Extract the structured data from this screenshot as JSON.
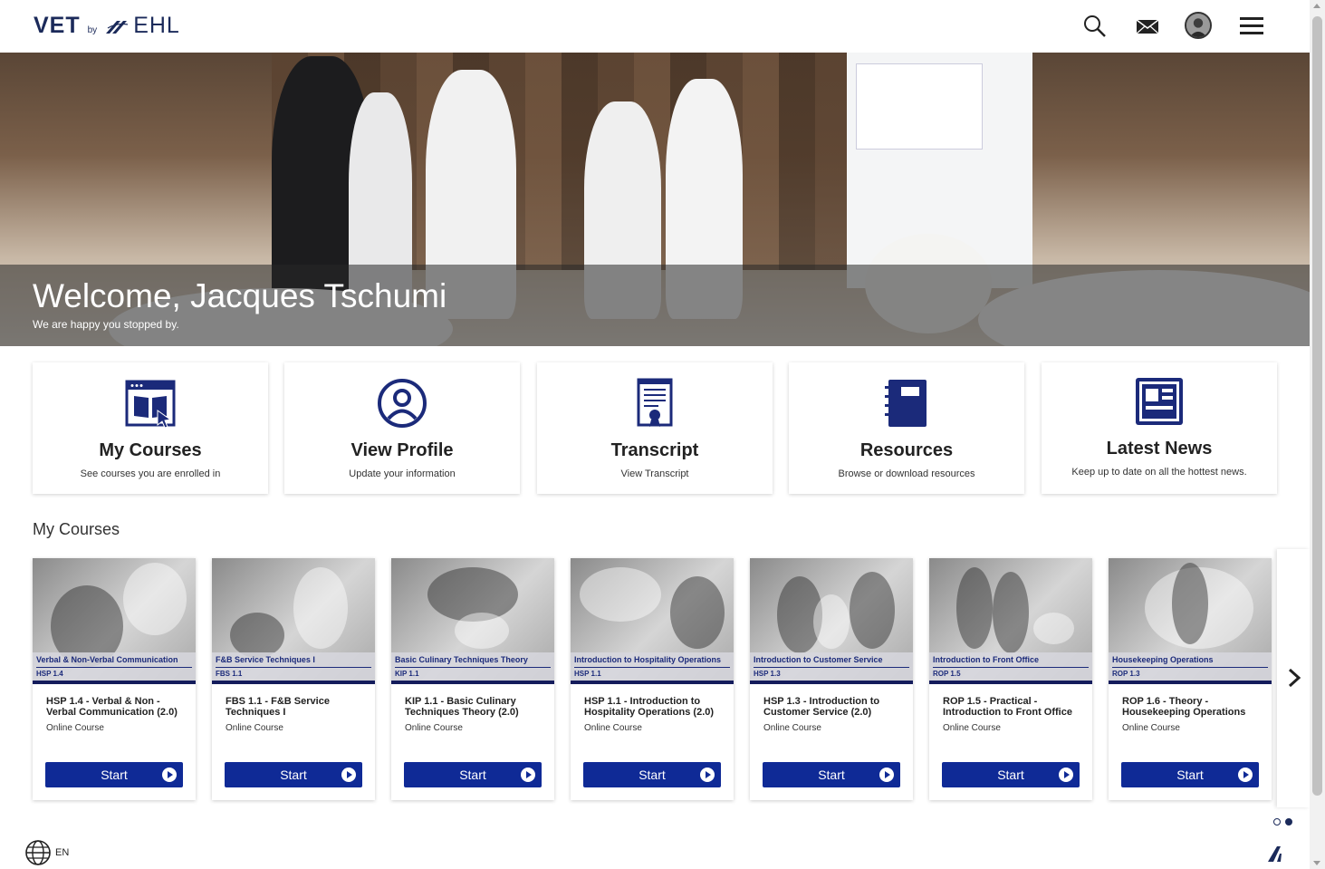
{
  "header": {
    "logo_vet": "VET",
    "logo_by": "by",
    "logo_ehl": "EHL",
    "icons": [
      "search-icon",
      "mail-icon",
      "avatar",
      "hamburger-menu-icon"
    ]
  },
  "hero": {
    "welcome": "Welcome, Jacques Tschumi",
    "subtitle": "We are happy you stopped by."
  },
  "tiles": [
    {
      "title": "My Courses",
      "subtitle": "See courses you are enrolled in",
      "icon": "course-book-icon"
    },
    {
      "title": "View Profile",
      "subtitle": "Update your information",
      "icon": "user-profile-icon"
    },
    {
      "title": "Transcript",
      "subtitle": "View Transcript",
      "icon": "certificate-icon"
    },
    {
      "title": "Resources",
      "subtitle": "Browse or download resources",
      "icon": "notebook-icon"
    },
    {
      "title": "Latest News",
      "subtitle": "Keep up to date on all the hottest news.",
      "icon": "newspaper-icon"
    }
  ],
  "section": {
    "title": "My Courses"
  },
  "courses": [
    {
      "band_title": "Verbal & Non-Verbal Communication",
      "band_code": "HSP 1.4",
      "title": "HSP 1.4 - Verbal & Non - Verbal Communication (2.0)",
      "type": "Online Course",
      "button": "Start"
    },
    {
      "band_title": "F&B Service Techniques I",
      "band_code": "FBS 1.1",
      "title": "FBS 1.1 - F&B Service Techniques I",
      "type": "Online Course",
      "button": "Start"
    },
    {
      "band_title": "Basic Culinary Techniques Theory",
      "band_code": "KIP 1.1",
      "title": "KIP 1.1 - Basic Culinary Techniques Theory (2.0)",
      "type": "Online Course",
      "button": "Start"
    },
    {
      "band_title": "Introduction to Hospitality Operations",
      "band_code": "HSP 1.1",
      "title": "HSP 1.1 - Introduction to Hospitality Operations (2.0)",
      "type": "Online Course",
      "button": "Start"
    },
    {
      "band_title": "Introduction to Customer Service",
      "band_code": "HSP 1.3",
      "title": "HSP 1.3 - Introduction to Customer Service (2.0)",
      "type": "Online Course",
      "button": "Start"
    },
    {
      "band_title": "Introduction to Front Office",
      "band_code": "ROP 1.5",
      "title": "ROP 1.5 - Practical - Introduction to Front Office",
      "type": "Online Course",
      "button": "Start"
    },
    {
      "band_title": "Housekeeping Operations",
      "band_code": "ROP 1.3",
      "title": "ROP 1.6 - Theory - Housekeeping Operations",
      "type": "Online Course",
      "button": "Start"
    }
  ],
  "footer": {
    "language": "EN"
  },
  "colors": {
    "brand_navy": "#1b2a5a",
    "button_blue": "#0f2a96",
    "card_bar": "#141c5c"
  }
}
